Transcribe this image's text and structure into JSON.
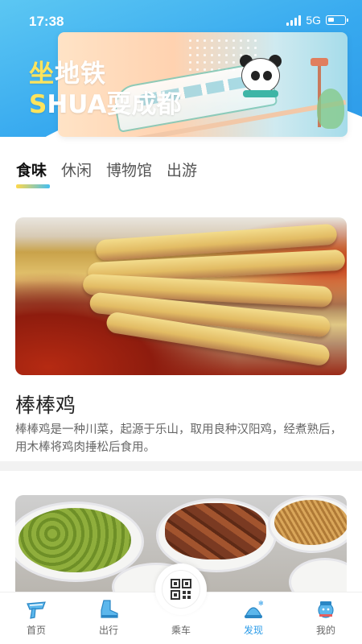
{
  "status_bar": {
    "time": "17:38",
    "network": "5G"
  },
  "banner": {
    "line1_accent": "坐",
    "line1_rest": "地铁",
    "line2_accent": "S",
    "line2_rest": "HUA耍成都"
  },
  "category_tabs": [
    {
      "label": "食味",
      "active": true
    },
    {
      "label": "休闲",
      "active": false
    },
    {
      "label": "博物馆",
      "active": false
    },
    {
      "label": "出游",
      "active": false
    }
  ],
  "feed": [
    {
      "title": "棒棒鸡",
      "description": "棒棒鸡是一种川菜，起源于乐山，取用良种汉阳鸡，经煮熟后，用木棒将鸡肉捶松后食用。"
    }
  ],
  "tabbar": {
    "items": [
      {
        "label": "首页",
        "icon": "scarf-icon",
        "active": false
      },
      {
        "label": "出行",
        "icon": "boot-icon",
        "active": false
      },
      {
        "label": "乘车",
        "icon": "qr-code-icon",
        "active": false
      },
      {
        "label": "发现",
        "icon": "snow-hat-icon",
        "active": true
      },
      {
        "label": "我的",
        "icon": "snowman-icon",
        "active": false
      }
    ]
  },
  "colors": {
    "primary": "#2a9be8",
    "tab_indicator_start": "#ffd84a",
    "tab_indicator_end": "#45bff1"
  }
}
